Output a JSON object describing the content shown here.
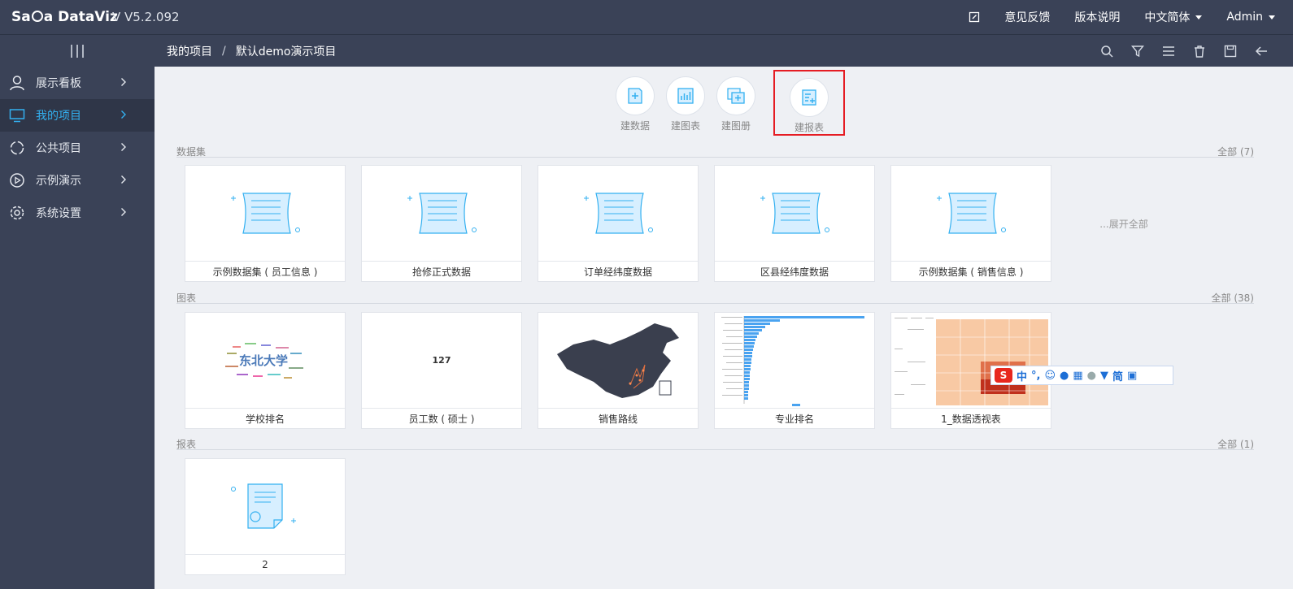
{
  "app": {
    "logo": "SaCa DataViz",
    "version": "V V5.2.092"
  },
  "topbar": {
    "feedback": "意见反馈",
    "release_notes": "版本说明",
    "language": "中文简体",
    "user": "Admin"
  },
  "breadcrumb": {
    "root": "我的项目",
    "separator": "/",
    "current": "默认demo演示项目"
  },
  "sidebar": {
    "items": [
      {
        "label": "展示看板",
        "icon": "user-icon"
      },
      {
        "label": "我的项目",
        "icon": "monitor-icon"
      },
      {
        "label": "公共项目",
        "icon": "ring-icon"
      },
      {
        "label": "示例演示",
        "icon": "play-icon"
      },
      {
        "label": "系统设置",
        "icon": "gear-icon"
      }
    ]
  },
  "actions": {
    "new_dataset": "建数据",
    "new_chart": "建图表",
    "new_album": "建图册",
    "new_report": "建报表"
  },
  "datasets": {
    "title": "数据集",
    "all_label": "全部",
    "count": "(7)",
    "expand": "...展开全部",
    "items": [
      "示例数据集 ( 员工信息 )",
      "抢修正式数据",
      "订单经纬度数据",
      "区县经纬度数据",
      "示例数据集 ( 销售信息 )"
    ]
  },
  "charts": {
    "title": "图表",
    "all_label": "全部",
    "count": "(38)",
    "items": [
      "学校排名",
      "员工数 ( 硕士 )",
      "销售路线",
      "专业排名",
      "1_数据透视表"
    ],
    "wordcloud_text": "东北大学",
    "kpi_value": "127"
  },
  "reports": {
    "title": "报表",
    "all_label": "全部",
    "count": "(1)",
    "items": [
      "2"
    ]
  },
  "ime": {
    "mode": "中",
    "punct": "°,",
    "simplified": "简"
  },
  "colors": {
    "topbar": "#3a4257",
    "accent": "#33b0f0",
    "highlight": "#e51c23"
  }
}
